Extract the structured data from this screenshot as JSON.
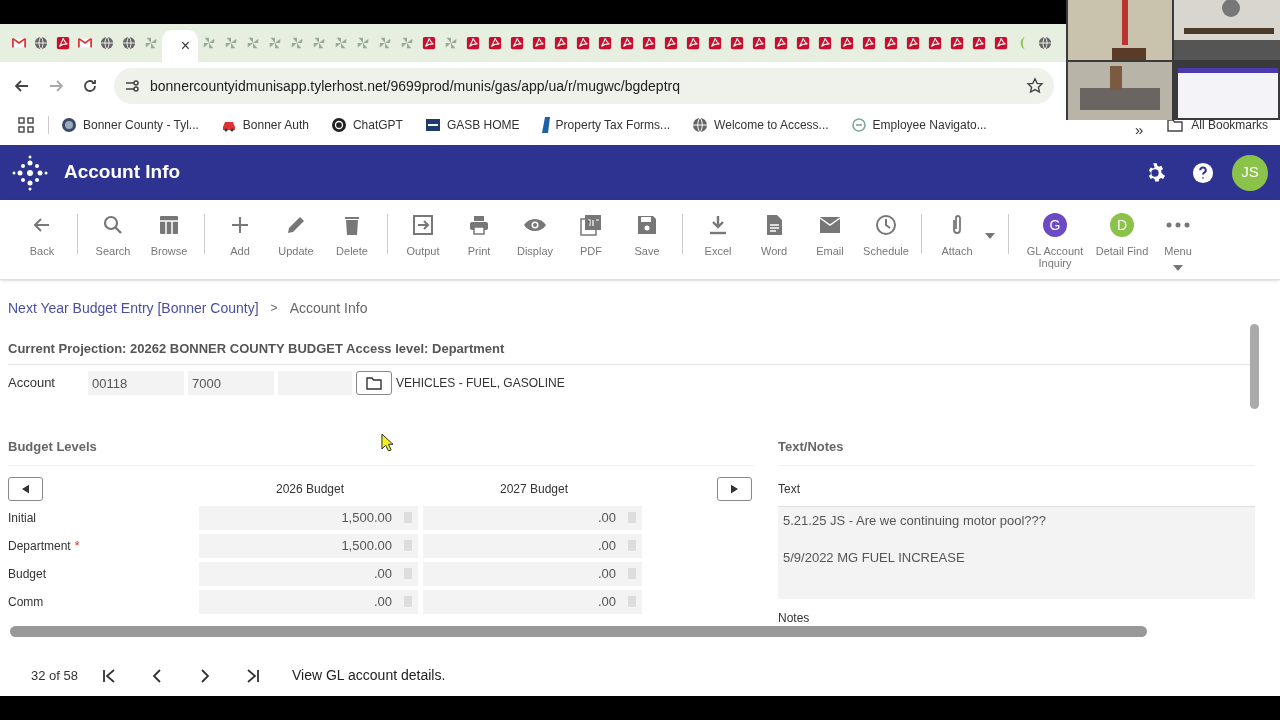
{
  "browser": {
    "tabs": [
      {
        "kind": "gmail",
        "selected": false
      },
      {
        "kind": "globe",
        "selected": false
      },
      {
        "kind": "pdf",
        "selected": false
      },
      {
        "kind": "gmail",
        "selected": false
      },
      {
        "kind": "globe",
        "selected": false
      },
      {
        "kind": "globe",
        "selected": false
      },
      {
        "kind": "pinwheel",
        "selected": false
      },
      {
        "kind": "blank",
        "selected": true,
        "close": "×"
      },
      {
        "kind": "pinwheel",
        "selected": false
      },
      {
        "kind": "pinwheel",
        "selected": false
      },
      {
        "kind": "pinwheel",
        "selected": false
      },
      {
        "kind": "pinwheel",
        "selected": false
      },
      {
        "kind": "pinwheel",
        "selected": false
      },
      {
        "kind": "pinwheel",
        "selected": false
      },
      {
        "kind": "pinwheel",
        "selected": false
      },
      {
        "kind": "pinwheel",
        "selected": false
      },
      {
        "kind": "pinwheel",
        "selected": false
      },
      {
        "kind": "pinwheel",
        "selected": false
      },
      {
        "kind": "pdf",
        "selected": false
      },
      {
        "kind": "pinwheel",
        "selected": false
      },
      {
        "kind": "pdf",
        "selected": false
      },
      {
        "kind": "pdf",
        "selected": false
      },
      {
        "kind": "pdf",
        "selected": false
      },
      {
        "kind": "pdf",
        "selected": false
      },
      {
        "kind": "pdf",
        "selected": false
      },
      {
        "kind": "pdf",
        "selected": false
      },
      {
        "kind": "pdf",
        "selected": false
      },
      {
        "kind": "pdf",
        "selected": false
      },
      {
        "kind": "pdf",
        "selected": false
      },
      {
        "kind": "pdf",
        "selected": false
      },
      {
        "kind": "pdf",
        "selected": false
      },
      {
        "kind": "pdf",
        "selected": false
      },
      {
        "kind": "pdf",
        "selected": false
      },
      {
        "kind": "pdf",
        "selected": false
      },
      {
        "kind": "pdf",
        "selected": false
      },
      {
        "kind": "pdf",
        "selected": false
      },
      {
        "kind": "pdf",
        "selected": false
      },
      {
        "kind": "pdf",
        "selected": false
      },
      {
        "kind": "pdf",
        "selected": false
      },
      {
        "kind": "pdf",
        "selected": false
      },
      {
        "kind": "pdf",
        "selected": false
      },
      {
        "kind": "pdf",
        "selected": false
      },
      {
        "kind": "pdf",
        "selected": false
      },
      {
        "kind": "pdf",
        "selected": false
      },
      {
        "kind": "pdf",
        "selected": false
      },
      {
        "kind": "leaf",
        "selected": false
      },
      {
        "kind": "globe",
        "selected": false
      }
    ],
    "url": "bonnercountyidmunisapp.tylerhost.net/9699prod/munis/gas/app/ua/r/mugwc/bgdeptrq",
    "bookmarks": [
      {
        "kind": "seal",
        "label": "Bonner County - Tyl..."
      },
      {
        "kind": "car",
        "label": "Bonner Auth"
      },
      {
        "kind": "knot",
        "label": "ChatGPT"
      },
      {
        "kind": "gasb",
        "label": "GASB HOME"
      },
      {
        "kind": "flag",
        "label": "Property Tax Forms..."
      },
      {
        "kind": "globe",
        "label": "Welcome to Access..."
      },
      {
        "kind": "ring",
        "label": "Employee Navigato..."
      }
    ],
    "more": "»",
    "all_bookmarks": "All Bookmarks"
  },
  "header": {
    "title": "Account Info",
    "avatar": "JS"
  },
  "toolbar": [
    {
      "kind": "back",
      "label": "Back",
      "separator": false,
      "dropdown": false
    },
    {
      "kind": "search",
      "label": "Search",
      "separator": true,
      "dropdown": false
    },
    {
      "kind": "browse",
      "label": "Browse",
      "separator": false,
      "dropdown": false
    },
    {
      "kind": "add",
      "label": "Add",
      "separator": true,
      "dropdown": false
    },
    {
      "kind": "update",
      "label": "Update",
      "separator": false,
      "dropdown": false
    },
    {
      "kind": "delete",
      "label": "Delete",
      "separator": false,
      "dropdown": false
    },
    {
      "kind": "output",
      "label": "Output",
      "separator": true,
      "dropdown": false
    },
    {
      "kind": "print",
      "label": "Print",
      "separator": false,
      "dropdown": false
    },
    {
      "kind": "display",
      "label": "Display",
      "separator": false,
      "dropdown": false
    },
    {
      "kind": "pdf",
      "label": "PDF",
      "separator": false,
      "dropdown": false
    },
    {
      "kind": "save",
      "label": "Save",
      "separator": false,
      "dropdown": false
    },
    {
      "kind": "excel",
      "label": "Excel",
      "separator": true,
      "dropdown": false
    },
    {
      "kind": "word",
      "label": "Word",
      "separator": false,
      "dropdown": false
    },
    {
      "kind": "email",
      "label": "Email",
      "separator": false,
      "dropdown": false
    },
    {
      "kind": "schedule",
      "label": "Schedule",
      "separator": false,
      "dropdown": false
    },
    {
      "kind": "attach",
      "label": "Attach",
      "separator": true,
      "dropdown": true
    },
    {
      "kind": "letter",
      "letter": "G",
      "color": "#6a4bc4",
      "label": "GL Account Inquiry",
      "separator": true,
      "dropdown": false
    },
    {
      "kind": "letter",
      "letter": "D",
      "color": "#8bc34a",
      "label": "Detail Find",
      "separator": false,
      "dropdown": false
    },
    {
      "kind": "more",
      "label": "Menu",
      "separator": false,
      "dropdown": true
    }
  ],
  "breadcrumb": {
    "link": "Next Year Budget Entry [Bonner County]",
    "separator": ">",
    "current": "Account Info"
  },
  "projection": "Current Projection: 20262 BONNER COUNTY BUDGET Access level: Department",
  "account": {
    "label": "Account",
    "segments": [
      "00118",
      "7000"
    ],
    "description": "VEHICLES - FUEL, GASOLINE"
  },
  "budget_levels": {
    "title": "Budget Levels",
    "columns": [
      "2026 Budget",
      "2027 Budget"
    ],
    "rows": [
      {
        "label": "Initial",
        "values": [
          "1,500.00",
          ".00"
        ]
      },
      {
        "label": "Department",
        "marker": "*",
        "values": [
          "1,500.00",
          ".00"
        ]
      },
      {
        "label": "Budget",
        "values": [
          ".00",
          ".00"
        ]
      },
      {
        "label": "Comm",
        "values": [
          ".00",
          ".00"
        ]
      }
    ]
  },
  "text_notes": {
    "title": "Text/Notes",
    "text_label": "Text",
    "lines": [
      "5.21.25 JS - Are we continuing motor pool???",
      "5/9/2022 MG FUEL INCREASE"
    ],
    "notes_label": "Notes"
  },
  "footer": {
    "position": "32 of 58",
    "message": "View GL account details."
  }
}
